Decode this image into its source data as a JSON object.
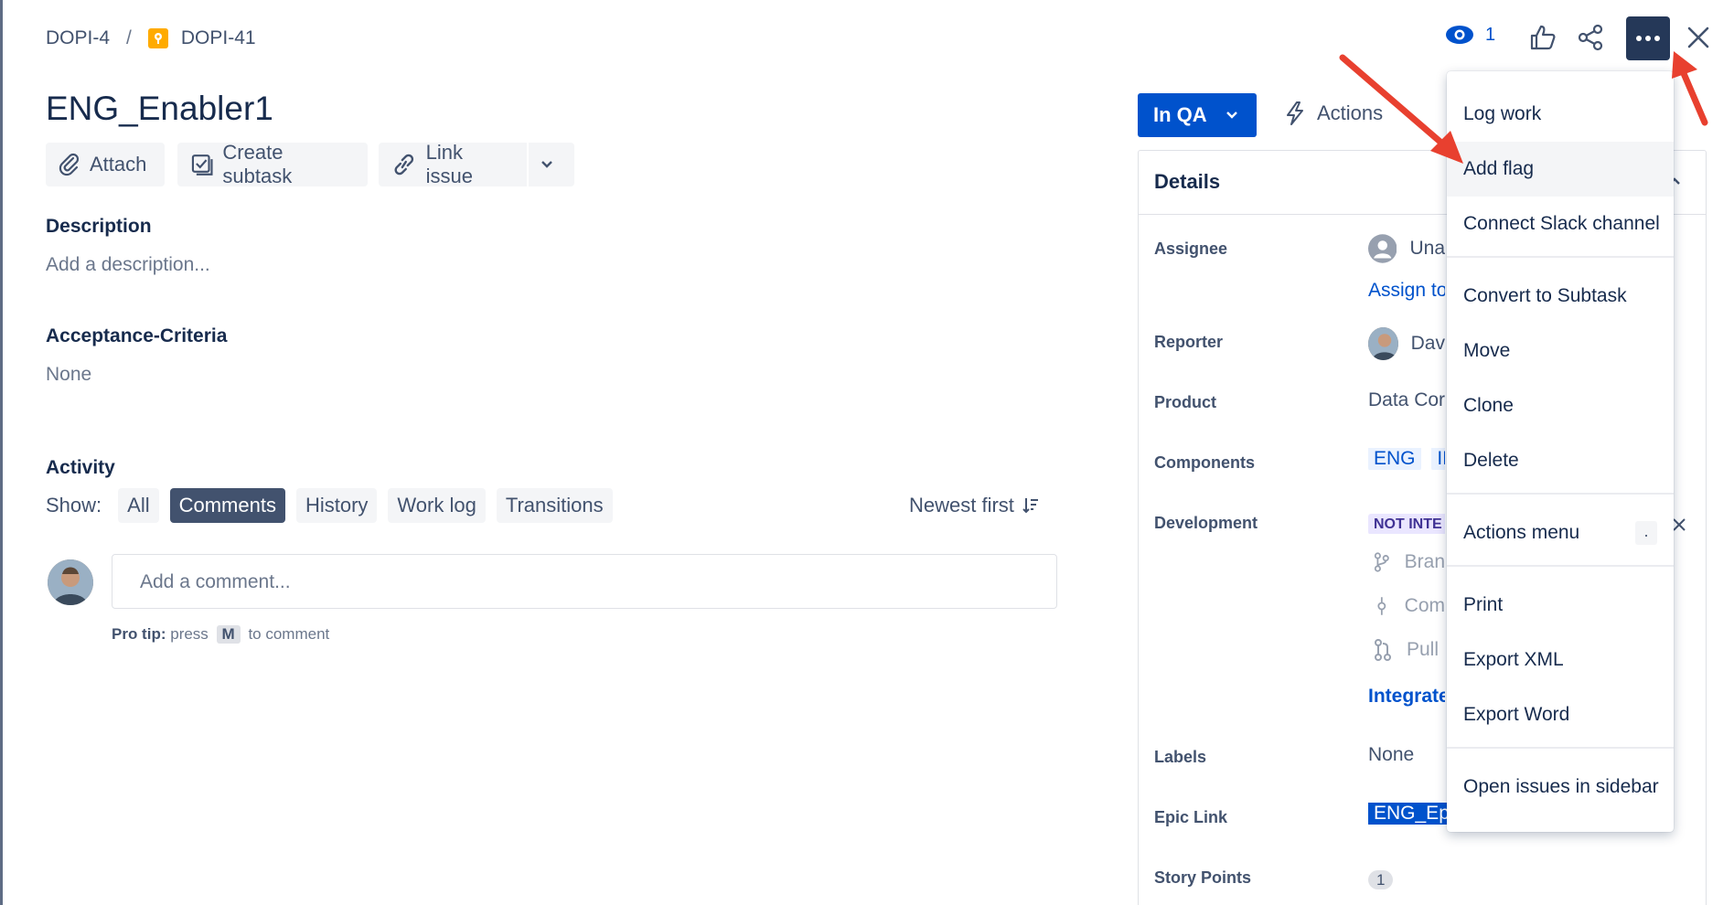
{
  "breadcrumb": {
    "parent": "DOPI-4",
    "separator": "/",
    "current": "DOPI-41"
  },
  "issue": {
    "title": "ENG_Enabler1"
  },
  "toolbar": {
    "attach": "Attach",
    "create_subtask": "Create subtask",
    "link_issue": "Link issue"
  },
  "description": {
    "heading": "Description",
    "placeholder": "Add a description..."
  },
  "acceptance": {
    "heading": "Acceptance-Criteria",
    "value": "None"
  },
  "activity": {
    "heading": "Activity",
    "show_label": "Show:",
    "filters": [
      "All",
      "Comments",
      "History",
      "Work log",
      "Transitions"
    ],
    "active_filter": "Comments",
    "sort": "Newest first",
    "comment_placeholder": "Add a comment...",
    "tip_bold": "Pro tip:",
    "tip_pre": "press",
    "tip_key": "M",
    "tip_post": "to comment"
  },
  "header": {
    "watch_count": "1"
  },
  "status": {
    "label": "In QA",
    "actions": "Actions"
  },
  "details": {
    "heading": "Details",
    "fields": {
      "assignee": {
        "label": "Assignee",
        "value": "Una",
        "action": "Assign to"
      },
      "reporter": {
        "label": "Reporter",
        "value": "Dav"
      },
      "product": {
        "label": "Product",
        "value": "Data Core"
      },
      "components": {
        "label": "Components",
        "values": [
          "ENG",
          "IF"
        ]
      },
      "development": {
        "label": "Development",
        "lozenge": "NOT INTE",
        "branches": "Bran",
        "commits": "Com",
        "pull": "Pull",
        "integrate": "Integrate"
      },
      "labels": {
        "label": "Labels",
        "value": "None"
      },
      "epic": {
        "label": "Epic Link",
        "value": "ENG_Epi"
      },
      "story_points": {
        "label": "Story Points",
        "value": "1"
      }
    }
  },
  "menu": {
    "items": [
      "Log work",
      "Add flag",
      "Connect Slack channel",
      "Convert to Subtask",
      "Move",
      "Clone",
      "Delete",
      "Actions menu",
      "Print",
      "Export XML",
      "Export Word",
      "Open issues in sidebar"
    ],
    "shortcut": ".",
    "hovered": "Add flag"
  },
  "colors": {
    "accent": "#0052cc",
    "dark": "#253858",
    "annotation": "#e8402f"
  }
}
